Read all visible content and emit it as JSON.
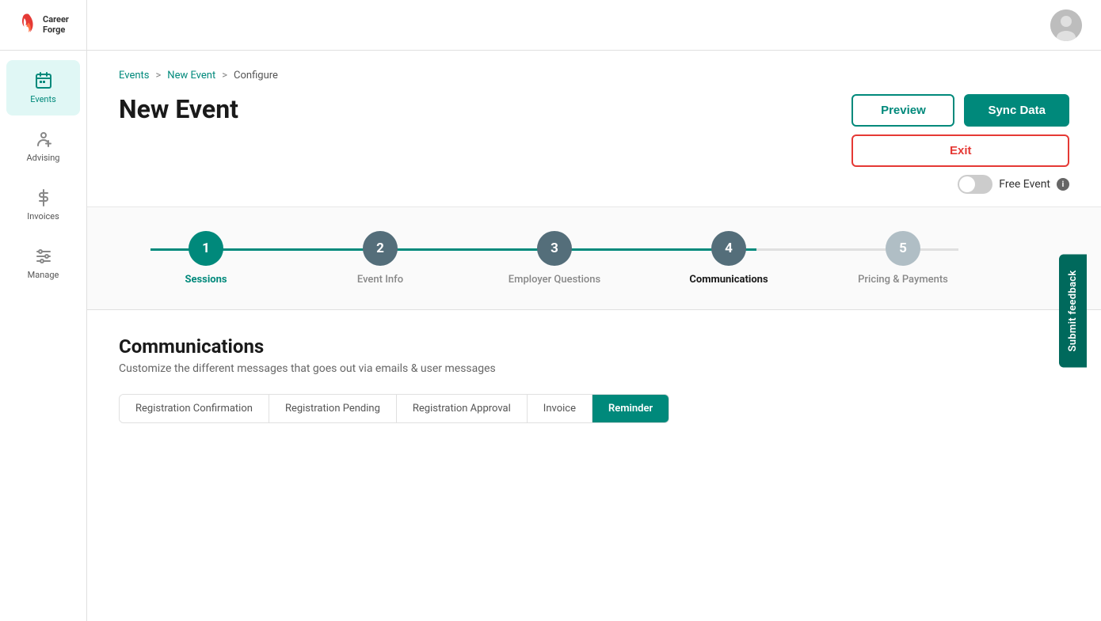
{
  "app": {
    "name": "Career Forge",
    "logo_text_line1": "Career",
    "logo_text_line2": "Forge"
  },
  "topbar": {
    "avatar_alt": "User avatar"
  },
  "sidebar": {
    "items": [
      {
        "id": "events",
        "label": "Events",
        "icon": "calendar",
        "active": true
      },
      {
        "id": "advising",
        "label": "Advising",
        "icon": "person",
        "active": false
      },
      {
        "id": "invoices",
        "label": "Invoices",
        "icon": "dollar",
        "active": false
      },
      {
        "id": "manage",
        "label": "Manage",
        "icon": "sliders",
        "active": false
      }
    ]
  },
  "breadcrumb": {
    "items": [
      {
        "label": "Events",
        "link": true
      },
      {
        "label": "New Event",
        "link": true
      },
      {
        "label": "Configure",
        "link": false
      }
    ]
  },
  "header": {
    "title": "New Event",
    "preview_btn": "Preview",
    "sync_btn": "Sync Data",
    "exit_btn": "Exit",
    "free_event_label": "Free Event",
    "free_event_info": "i"
  },
  "steps": [
    {
      "number": "1",
      "label": "Sessions",
      "state": "active"
    },
    {
      "number": "2",
      "label": "Event Info",
      "state": "done"
    },
    {
      "number": "3",
      "label": "Employer Questions",
      "state": "done"
    },
    {
      "number": "4",
      "label": "Communications",
      "state": "current"
    },
    {
      "number": "5",
      "label": "Pricing & Payments",
      "state": "future"
    }
  ],
  "communications": {
    "title": "Communications",
    "subtitle": "Customize the different messages that goes out via emails & user messages",
    "tabs": [
      {
        "label": "Registration Confirmation",
        "active": false
      },
      {
        "label": "Registration Pending",
        "active": false
      },
      {
        "label": "Registration Approval",
        "active": false
      },
      {
        "label": "Invoice",
        "active": false
      },
      {
        "label": "Reminder",
        "active": true
      }
    ]
  },
  "feedback": {
    "label": "Submit feedback"
  }
}
